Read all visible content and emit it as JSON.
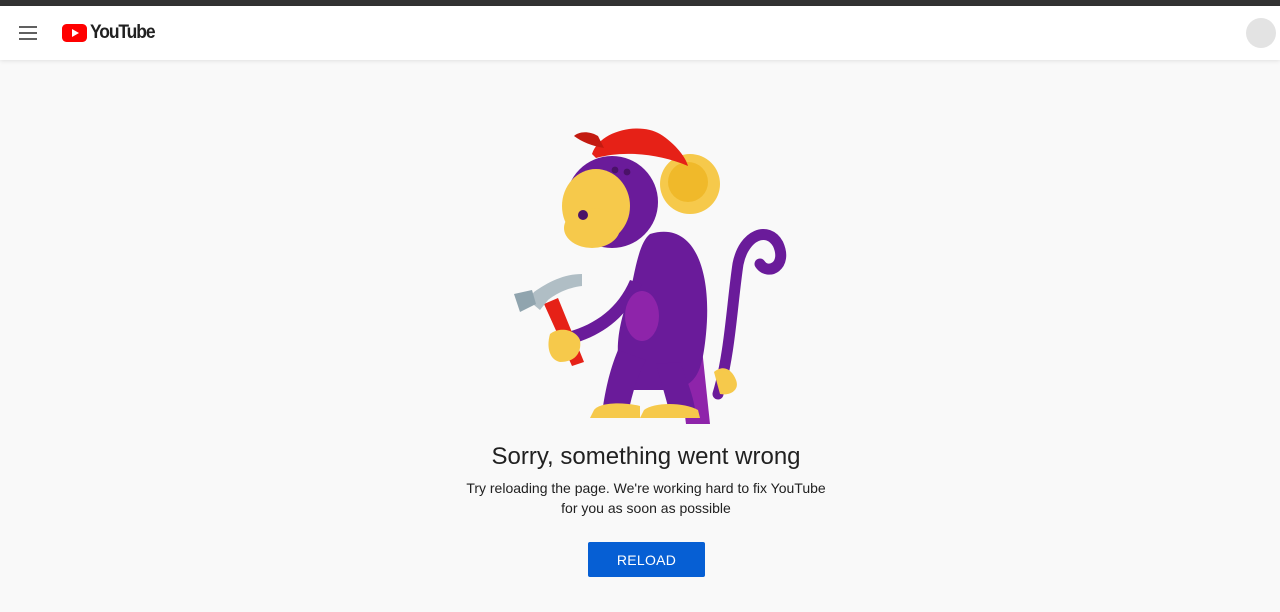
{
  "header": {
    "logo_text": "YouTube",
    "menu_icon": "hamburger-menu-icon",
    "logo_icon": "youtube-play-icon",
    "avatar_icon": "avatar-placeholder"
  },
  "error": {
    "illustration": "monkey-with-hammer",
    "title": "Sorry, something went wrong",
    "description": "Try reloading the page. We're working hard to fix YouTube for you as soon as possible",
    "reload_label": "RELOAD"
  },
  "colors": {
    "brand_red": "#ff0000",
    "button_blue": "#065fd4",
    "background": "#f9f9f9",
    "monkey_purple": "#6a1b9a",
    "monkey_yellow": "#f6c94b"
  }
}
